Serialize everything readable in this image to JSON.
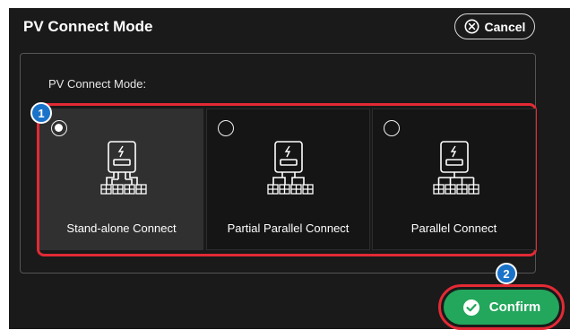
{
  "dialog": {
    "title": "PV Connect Mode",
    "cancel_label": "Cancel",
    "section_label": "PV Connect Mode:",
    "confirm_label": "Confirm"
  },
  "options": [
    {
      "label": "Stand-alone Connect",
      "selected": true
    },
    {
      "label": "Partial Parallel Connect",
      "selected": false
    },
    {
      "label": "Parallel Connect",
      "selected": false
    }
  ],
  "annotations": {
    "step1": "1",
    "step2": "2"
  },
  "colors": {
    "background": "#1a1a1a",
    "highlight": "#e22a35",
    "confirm": "#23a75c",
    "badge": "#1a73c9"
  },
  "icons": {
    "cancel": "close-circle-icon",
    "confirm": "check-circle-icon",
    "option": "inverter-panels-icon"
  }
}
